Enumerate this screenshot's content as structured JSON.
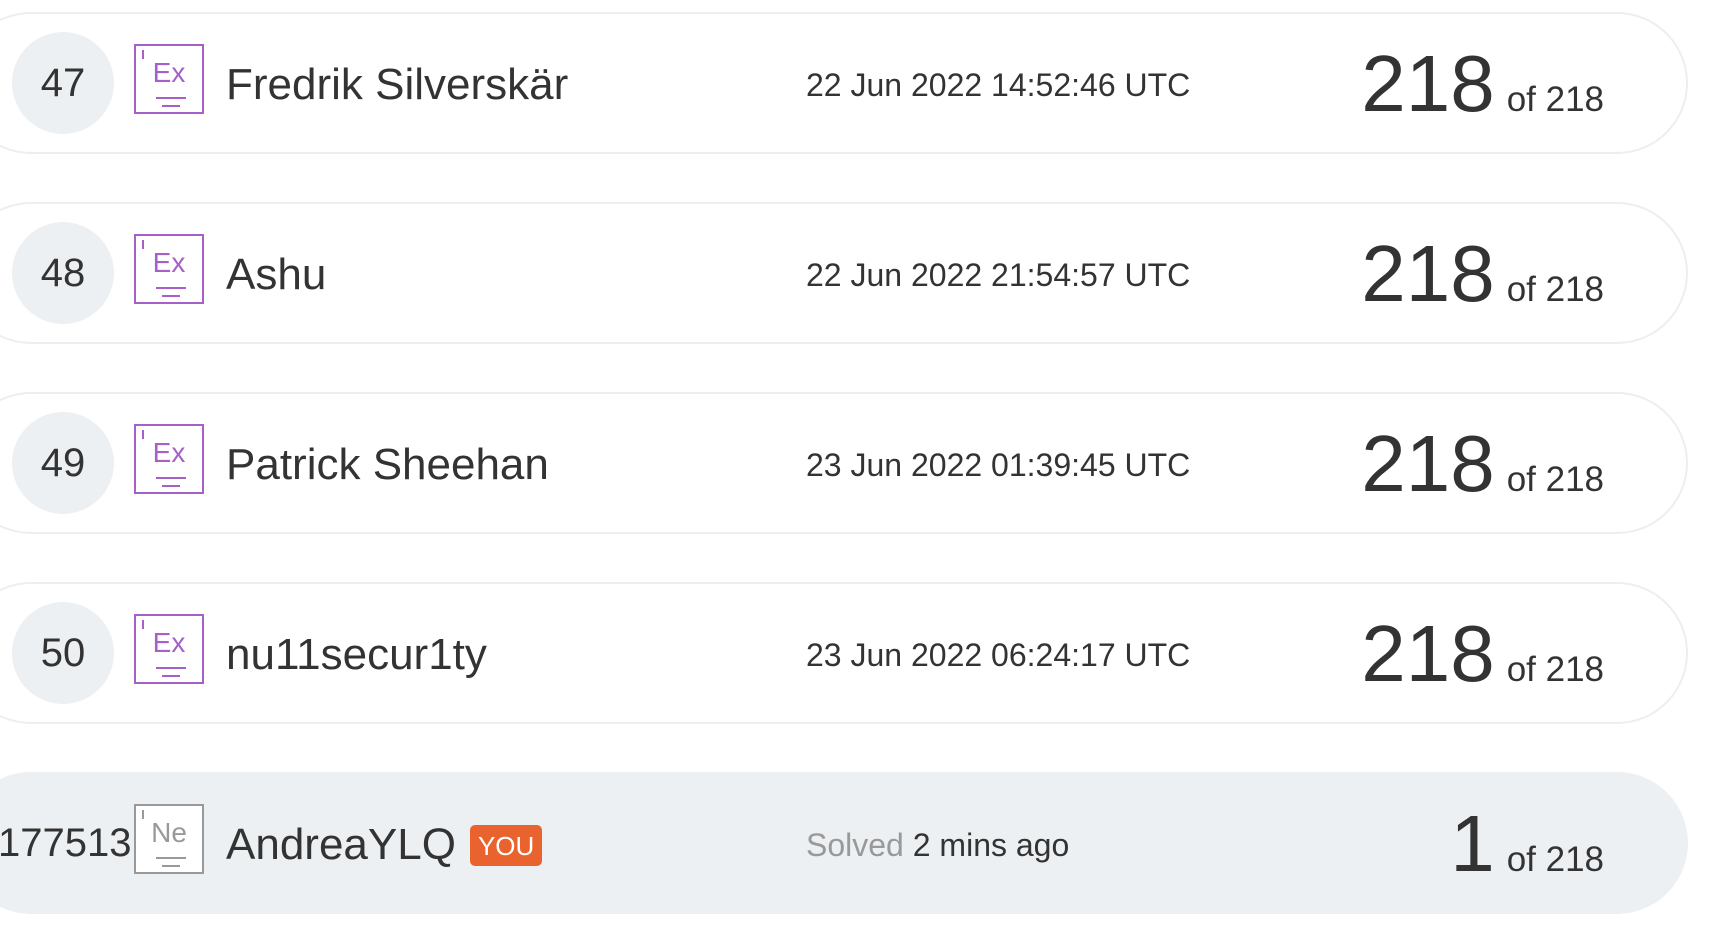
{
  "total": "218",
  "of_prefix": "of",
  "you_label": "YOU",
  "solved_label": "Solved",
  "rows": [
    {
      "rank": "47",
      "badge": "Ex",
      "name": "Fredrik Silverskär",
      "time": "22 Jun 2022 14:52:46 UTC",
      "score": "218",
      "of_text": "of 218"
    },
    {
      "rank": "48",
      "badge": "Ex",
      "name": "Ashu",
      "time": "22 Jun 2022 21:54:57 UTC",
      "score": "218",
      "of_text": "of 218"
    },
    {
      "rank": "49",
      "badge": "Ex",
      "name": "Patrick Sheehan",
      "time": "23 Jun 2022 01:39:45 UTC",
      "score": "218",
      "of_text": "of 218"
    },
    {
      "rank": "50",
      "badge": "Ex",
      "name": "nu11secur1ty",
      "time": "23 Jun 2022 06:24:17 UTC",
      "score": "218",
      "of_text": "of 218"
    }
  ],
  "me": {
    "rank": "177513",
    "badge": "Ne",
    "name": "AndreaYLQ",
    "solved_label": "Solved",
    "solved_ago": "2 mins ago",
    "score": "1",
    "of_text": "of 218"
  },
  "colors": {
    "badge_expert": "#a660c8",
    "badge_newbie": "#999999",
    "you_tag": "#e8632d",
    "highlight_row": "#edf0f2"
  }
}
